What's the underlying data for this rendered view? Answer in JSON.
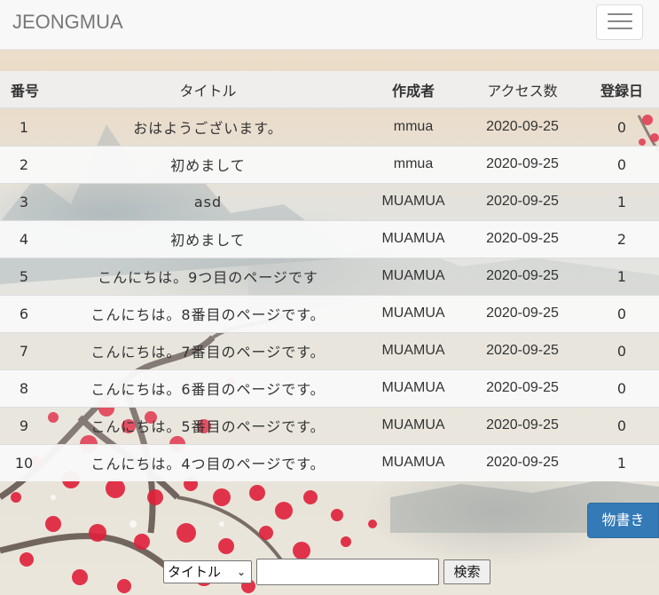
{
  "navbar": {
    "brand": "JEONGMUA"
  },
  "table": {
    "headers": {
      "no": "番号",
      "title": "タイトル",
      "author": "作成者",
      "access": "アクセス数",
      "date": "登録日"
    },
    "rows": [
      {
        "no": "1",
        "title": "おはようございます。",
        "author": "mmua",
        "access": "2020-09-25",
        "date": "0"
      },
      {
        "no": "2",
        "title": "初めまして",
        "author": "mmua",
        "access": "2020-09-25",
        "date": "0"
      },
      {
        "no": "3",
        "title": "asd",
        "author": "MUAMUA",
        "access": "2020-09-25",
        "date": "1"
      },
      {
        "no": "4",
        "title": "初めまして",
        "author": "MUAMUA",
        "access": "2020-09-25",
        "date": "2"
      },
      {
        "no": "5",
        "title": "こんにちは。9つ目のページです",
        "author": "MUAMUA",
        "access": "2020-09-25",
        "date": "1"
      },
      {
        "no": "6",
        "title": "こんにちは。8番目のページです。",
        "author": "MUAMUA",
        "access": "2020-09-25",
        "date": "0"
      },
      {
        "no": "7",
        "title": "こんにちは。7番目のページです。",
        "author": "MUAMUA",
        "access": "2020-09-25",
        "date": "0"
      },
      {
        "no": "8",
        "title": "こんにちは。6番目のページです。",
        "author": "MUAMUA",
        "access": "2020-09-25",
        "date": "0"
      },
      {
        "no": "9",
        "title": "こんにちは。5番目のページです。",
        "author": "MUAMUA",
        "access": "2020-09-25",
        "date": "0"
      },
      {
        "no": "10",
        "title": "こんにちは。4つ目のページです。",
        "author": "MUAMUA",
        "access": "2020-09-25",
        "date": "1"
      }
    ]
  },
  "write_button": "物書き",
  "search": {
    "select_value": "タイトル",
    "input_value": "",
    "button_label": "検索"
  },
  "icons": {
    "menu": "hamburger-menu-icon",
    "select": "chevron-down-icon"
  },
  "colors": {
    "primary": "#337ab7",
    "navbar_bg": "#f8f8f8",
    "brand_text": "#777777"
  }
}
